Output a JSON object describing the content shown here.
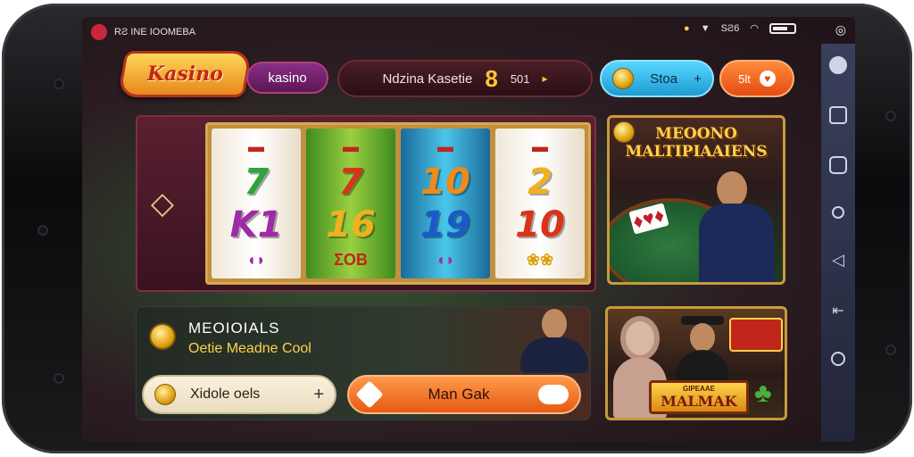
{
  "status_bar": {
    "carrier": "RƧ INE IOOMEBA",
    "network": "SƧ6"
  },
  "header": {
    "logo_text": "Kasino",
    "casino_tab": "kasino",
    "center_label": "Ndzina Kasetie",
    "center_number": "8",
    "center_small": "501",
    "stake_label": "Stoa",
    "stake_plus": "+",
    "orange_label": "5lt"
  },
  "slot": {
    "reels": [
      {
        "symbols": [
          "7",
          "K1",
          ""
        ],
        "top": "",
        "bottom": ""
      },
      {
        "symbols": [
          "7",
          "16"
        ],
        "bottom": "ΣOB"
      },
      {
        "symbols": [
          "10",
          "19"
        ],
        "bottom": ""
      },
      {
        "symbols": [
          "2",
          "10"
        ],
        "bottom": ""
      }
    ]
  },
  "promo": {
    "title_line1": "MEOONO",
    "title_line2": "MALTIPIAAIENS"
  },
  "info": {
    "title": "MEOIOIALS",
    "subtitle": "Oetie Meadne Cool",
    "input_value": "Xidole oels",
    "input_plus": "+",
    "button_label": "Man Gak"
  },
  "game": {
    "banner_small": "GIPEAAE",
    "banner_big": "MALMAK"
  },
  "colors": {
    "accent_orange": "#e55a14",
    "accent_blue": "#1d9bd2",
    "gold": "#ffd24a"
  }
}
